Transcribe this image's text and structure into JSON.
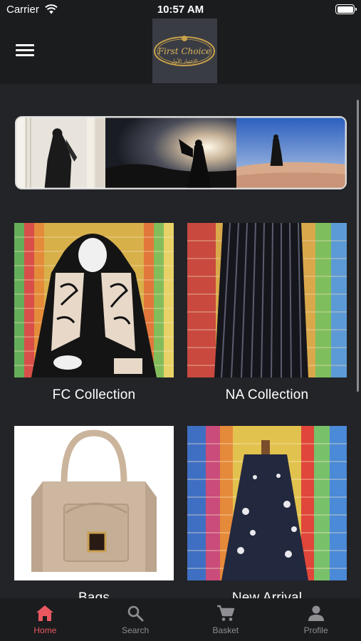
{
  "status": {
    "carrier": "Carrier",
    "time": "10:57 AM"
  },
  "brand": {
    "logo_text": "First Choice",
    "logo_text_arabic": "الإختيار الأول"
  },
  "collections": [
    {
      "label": "FC Collection"
    },
    {
      "label": "NA Collection"
    },
    {
      "label": "Bags"
    },
    {
      "label": "New Arrival"
    }
  ],
  "tabs": [
    {
      "label": "Home",
      "icon": "home-icon"
    },
    {
      "label": "Search",
      "icon": "search-icon"
    },
    {
      "label": "Basket",
      "icon": "cart-icon"
    },
    {
      "label": "Profile",
      "icon": "person-icon"
    }
  ],
  "colors": {
    "background": "#232427",
    "bar": "#1b1c1e",
    "active_tab": "#e9585f",
    "inactive_tab": "#8e8e93",
    "logo_gold": "#c9a24a"
  }
}
